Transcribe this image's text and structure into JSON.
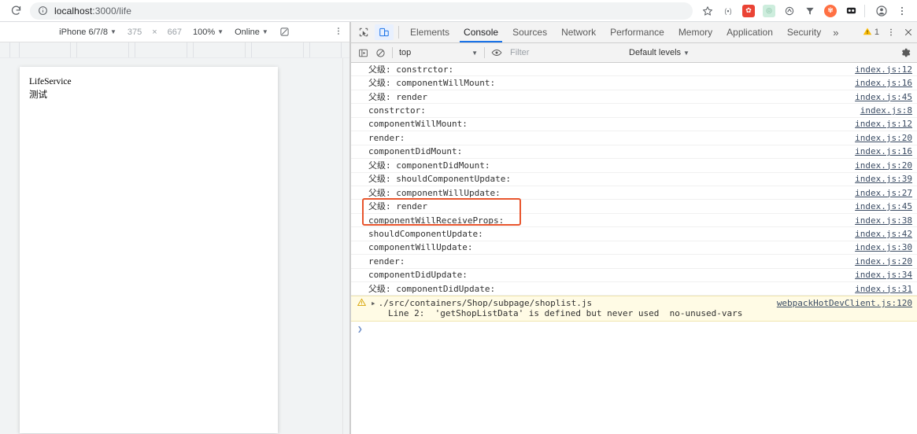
{
  "browser": {
    "reload_icon": "reload-icon",
    "url_prefix": "localhost",
    "url_suffix": ":3000/life",
    "url_full": "localhost:3000/life",
    "info_icon": "info-circle-icon",
    "star_icon": "bookmark-star-icon",
    "extensions": [
      {
        "name": "extension-icon-1",
        "label": "(▪)",
        "color": "#ffffff",
        "text": "#5f6368"
      },
      {
        "name": "extension-icon-2",
        "label": "☗",
        "color": "#ea4335",
        "text": "#ffffff"
      },
      {
        "name": "extension-icon-3",
        "label": "◎",
        "color": "#b7e1cd",
        "text": "#ffffff"
      },
      {
        "name": "extension-icon-4",
        "label": "◔",
        "color": "#ffffff",
        "text": "#5f6368"
      },
      {
        "name": "extension-icon-5",
        "label": "▼",
        "color": "#ffffff",
        "text": "#5f6368"
      },
      {
        "name": "extension-icon-6",
        "label": "✹",
        "color": "#ff6d00",
        "text": "#ffffff"
      },
      {
        "name": "extension-icon-7",
        "label": "◑",
        "color": "#202124",
        "text": "#ffffff"
      }
    ],
    "profile_icon": "profile-avatar-icon",
    "menu_icon": "chrome-menu-icon"
  },
  "device": {
    "device_name": "iPhone 6/7/8",
    "width": "375",
    "x_symbol": "×",
    "height": "667",
    "zoom": "100%",
    "throttle": "Online",
    "rotate_icon": "rotate-device-icon",
    "more_icon": "device-more-options-icon",
    "page": {
      "line1": "LifeService",
      "line2": "测试"
    }
  },
  "devtools": {
    "inspect_icon": "inspect-element-icon",
    "device_toggle_icon": "toggle-device-toolbar-icon",
    "tabs": [
      {
        "label": "Elements",
        "active": false
      },
      {
        "label": "Console",
        "active": true
      },
      {
        "label": "Sources",
        "active": false
      },
      {
        "label": "Network",
        "active": false
      },
      {
        "label": "Performance",
        "active": false
      },
      {
        "label": "Memory",
        "active": false
      },
      {
        "label": "Application",
        "active": false
      },
      {
        "label": "Security",
        "active": false
      }
    ],
    "more_tabs": "»",
    "warning_count": "1",
    "warning_icon": "warning-triangle-icon",
    "panel_menu_icon": "devtools-more-options-icon",
    "close_icon": "close-devtools-icon",
    "filterbar": {
      "sidebar_icon": "console-sidebar-icon",
      "clear_icon": "clear-console-icon",
      "context": "top",
      "eye_icon": "live-expression-icon",
      "filter_placeholder": "Filter",
      "levels": "Default levels",
      "settings_icon": "console-settings-icon"
    },
    "console": {
      "rows": [
        {
          "msg": "父级: constrctor:",
          "src": "index.js:12"
        },
        {
          "msg": "父级: componentWillMount:",
          "src": "index.js:16"
        },
        {
          "msg": "父级: render",
          "src": "index.js:45"
        },
        {
          "msg": "constrctor:",
          "src": "index.js:8"
        },
        {
          "msg": "componentWillMount:",
          "src": "index.js:12"
        },
        {
          "msg": "render:",
          "src": "index.js:20"
        },
        {
          "msg": "componentDidMount:",
          "src": "index.js:16"
        },
        {
          "msg": "父级: componentDidMount:",
          "src": "index.js:20"
        },
        {
          "msg": "父级: shouldComponentUpdate:",
          "src": "index.js:39"
        },
        {
          "msg": "父级: componentWillUpdate:",
          "src": "index.js:27"
        },
        {
          "msg": "父级: render",
          "src": "index.js:45"
        },
        {
          "msg": "componentWillReceiveProps:",
          "src": "index.js:38"
        },
        {
          "msg": "shouldComponentUpdate:",
          "src": "index.js:42"
        },
        {
          "msg": "componentWillUpdate:",
          "src": "index.js:30"
        },
        {
          "msg": "render:",
          "src": "index.js:20"
        },
        {
          "msg": "componentDidUpdate:",
          "src": "index.js:34"
        },
        {
          "msg": "父级: componentDidUpdate:",
          "src": "index.js:31"
        }
      ],
      "warning": {
        "icon": "warning-triangle-icon",
        "expand_arrow": "▸",
        "line1": "./src/containers/Shop/subpage/shoplist.js",
        "line2": "Line 2:  'getShopListData' is defined but never used  no-unused-vars",
        "src": "webpackHotDevClient.js:120"
      },
      "prompt_caret": "❯"
    },
    "annotation": {
      "name": "red-highlight-box",
      "color": "#e8552d"
    }
  }
}
